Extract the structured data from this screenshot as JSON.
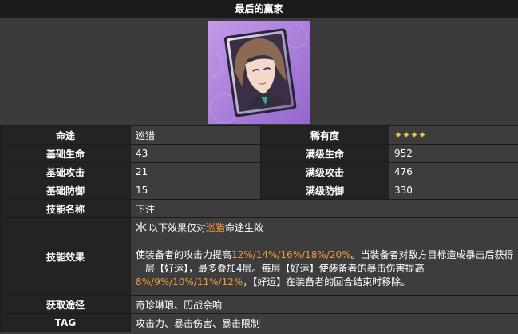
{
  "title": "最后的赢家",
  "stats": [
    {
      "label": "命途",
      "value": "巡猎",
      "label2": "稀有度",
      "value2": "✦✦✦✦"
    },
    {
      "label": "基础生命",
      "value": "43",
      "label2": "满级生命",
      "value2": "952"
    },
    {
      "label": "基础攻击",
      "value": "21",
      "label2": "满级攻击",
      "value2": "476"
    },
    {
      "label": "基础防御",
      "value": "15",
      "label2": "满级防御",
      "value2": "330"
    }
  ],
  "skill": {
    "name_label": "技能名称",
    "name": "下注",
    "effect_label": "技能效果",
    "note_a": "以下效果仅对",
    "note_path": "巡猎",
    "note_b": "命途生效",
    "desc1_a": "使装备者的攻击力提高",
    "desc1_hl": "12%/14%/16%/18%/20%",
    "desc1_b": "。当装备者对敌方目标造成暴击后获得",
    "desc2": "一层【好运】，最多叠加4层。每层【好运】使装备者的暴击伤害提高",
    "desc3_hl": "8%/9%/10%/11%/12%",
    "desc3_b": "，【好运】在装备者的回合结束时移除。"
  },
  "source": {
    "label": "获取途径",
    "value": "奇珍琳琅、历战余响"
  },
  "tag": {
    "label": "TAG",
    "value": "攻击力、暴击伤害、暴击限制"
  },
  "colors": {
    "highlight": "#f29a3a",
    "stars": "#f0c850",
    "header_bg": "#232323",
    "card_bg": "#9a6fd0"
  }
}
